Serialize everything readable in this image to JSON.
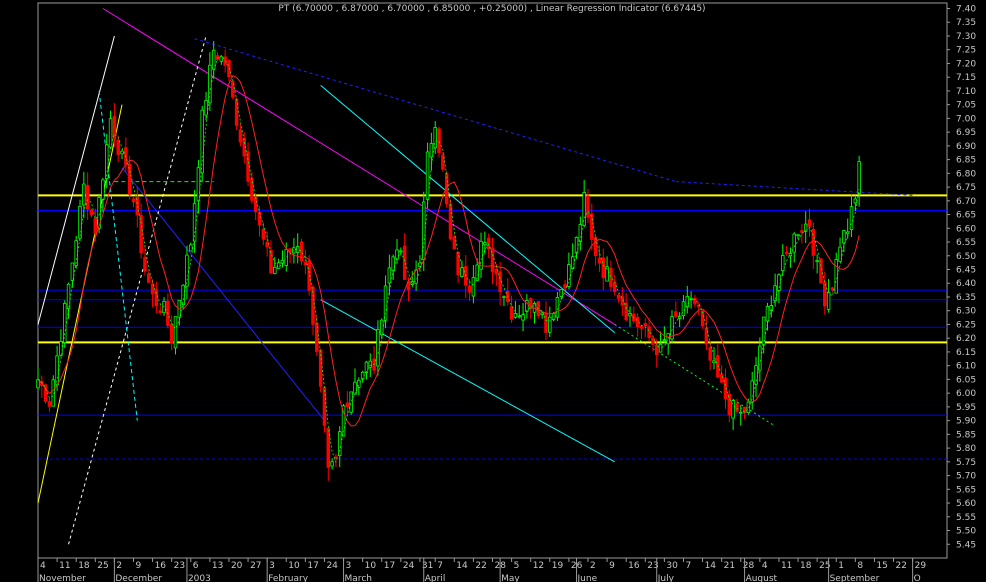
{
  "chart_data": {
    "type": "candlestick",
    "title": "PT (6.70000 , 6.87000 , 6.70000 , 6.85000 , +0.25000) , Linear Regression Indicator (6.67445)",
    "ylim": [
      5.4,
      7.42
    ],
    "yticks": [
      "7.40",
      "7.35",
      "7.30",
      "7.25",
      "7.20",
      "7.15",
      "7.10",
      "7.05",
      "7.00",
      "6.95",
      "6.90",
      "6.85",
      "6.80",
      "6.75",
      "6.70",
      "6.65",
      "6.60",
      "6.55",
      "6.50",
      "6.45",
      "6.40",
      "6.35",
      "6.30",
      "6.25",
      "6.20",
      "6.15",
      "6.10",
      "6.05",
      "6.00",
      "5.95",
      "5.90",
      "5.85",
      "5.80",
      "5.75",
      "5.70",
      "5.65",
      "5.60",
      "5.55",
      "5.50",
      "5.45"
    ],
    "xlim": [
      0,
      238
    ],
    "dayticks": [
      {
        "x": 0,
        "label": "4"
      },
      {
        "x": 5,
        "label": "11"
      },
      {
        "x": 10,
        "label": "18"
      },
      {
        "x": 15,
        "label": "25"
      },
      {
        "x": 20,
        "label": "2"
      },
      {
        "x": 25,
        "label": "9"
      },
      {
        "x": 30,
        "label": "16"
      },
      {
        "x": 35,
        "label": "23"
      },
      {
        "x": 40,
        "label": "6"
      },
      {
        "x": 45,
        "label": "13"
      },
      {
        "x": 50,
        "label": "20"
      },
      {
        "x": 55,
        "label": "27"
      },
      {
        "x": 60,
        "label": "3"
      },
      {
        "x": 65,
        "label": "10"
      },
      {
        "x": 70,
        "label": "17"
      },
      {
        "x": 75,
        "label": "24"
      },
      {
        "x": 80,
        "label": "3"
      },
      {
        "x": 85,
        "label": "10"
      },
      {
        "x": 90,
        "label": "17"
      },
      {
        "x": 95,
        "label": "24"
      },
      {
        "x": 100,
        "label": "31"
      },
      {
        "x": 104,
        "label": "7"
      },
      {
        "x": 109,
        "label": "14"
      },
      {
        "x": 114,
        "label": "22"
      },
      {
        "x": 119,
        "label": "28"
      },
      {
        "x": 124,
        "label": "5"
      },
      {
        "x": 129,
        "label": "12"
      },
      {
        "x": 134,
        "label": "19"
      },
      {
        "x": 139,
        "label": "26"
      },
      {
        "x": 144,
        "label": "2"
      },
      {
        "x": 149,
        "label": "9"
      },
      {
        "x": 154,
        "label": "16"
      },
      {
        "x": 159,
        "label": "23"
      },
      {
        "x": 164,
        "label": "30"
      },
      {
        "x": 169,
        "label": "7"
      },
      {
        "x": 174,
        "label": "14"
      },
      {
        "x": 179,
        "label": "21"
      },
      {
        "x": 184,
        "label": "28"
      },
      {
        "x": 189,
        "label": "4"
      },
      {
        "x": 194,
        "label": "11"
      },
      {
        "x": 199,
        "label": "18"
      },
      {
        "x": 204,
        "label": "25"
      },
      {
        "x": 209,
        "label": "1"
      },
      {
        "x": 214,
        "label": "8"
      },
      {
        "x": 219,
        "label": "15"
      },
      {
        "x": 224,
        "label": "22"
      },
      {
        "x": 229,
        "label": "29"
      }
    ],
    "months": [
      {
        "x": 0,
        "label": "November"
      },
      {
        "x": 20,
        "label": "December"
      },
      {
        "x": 39,
        "label": "2003"
      },
      {
        "x": 60,
        "label": "February"
      },
      {
        "x": 80,
        "label": "March"
      },
      {
        "x": 101,
        "label": "April"
      },
      {
        "x": 121,
        "label": "May"
      },
      {
        "x": 141,
        "label": "June"
      },
      {
        "x": 162,
        "label": "July"
      },
      {
        "x": 185,
        "label": "August"
      },
      {
        "x": 207,
        "label": "September"
      },
      {
        "x": 229,
        "label": "O"
      }
    ],
    "anchors": [
      [
        0,
        6.05
      ],
      [
        3,
        5.97
      ],
      [
        7,
        6.3
      ],
      [
        12,
        6.75
      ],
      [
        15,
        6.6
      ],
      [
        19,
        7.0
      ],
      [
        22,
        6.85
      ],
      [
        25,
        6.7
      ],
      [
        28,
        6.45
      ],
      [
        30,
        6.35
      ],
      [
        33,
        6.3
      ],
      [
        35,
        6.2
      ],
      [
        37,
        6.35
      ],
      [
        40,
        6.55
      ],
      [
        43,
        7.0
      ],
      [
        46,
        7.25
      ],
      [
        49,
        7.2
      ],
      [
        52,
        7.0
      ],
      [
        55,
        6.8
      ],
      [
        58,
        6.6
      ],
      [
        61,
        6.45
      ],
      [
        65,
        6.5
      ],
      [
        68,
        6.55
      ],
      [
        71,
        6.4
      ],
      [
        74,
        6.0
      ],
      [
        76,
        5.7
      ],
      [
        78,
        5.75
      ],
      [
        80,
        5.95
      ],
      [
        83,
        6.05
      ],
      [
        86,
        6.1
      ],
      [
        88,
        6.1
      ],
      [
        91,
        6.4
      ],
      [
        94,
        6.55
      ],
      [
        97,
        6.35
      ],
      [
        100,
        6.5
      ],
      [
        102,
        6.85
      ],
      [
        104,
        7.0
      ],
      [
        106,
        6.8
      ],
      [
        108,
        6.55
      ],
      [
        110,
        6.45
      ],
      [
        113,
        6.4
      ],
      [
        116,
        6.55
      ],
      [
        118,
        6.5
      ],
      [
        121,
        6.4
      ],
      [
        124,
        6.3
      ],
      [
        127,
        6.3
      ],
      [
        130,
        6.35
      ],
      [
        133,
        6.25
      ],
      [
        136,
        6.35
      ],
      [
        139,
        6.45
      ],
      [
        141,
        6.55
      ],
      [
        143,
        6.7
      ],
      [
        145,
        6.55
      ],
      [
        148,
        6.45
      ],
      [
        151,
        6.4
      ],
      [
        154,
        6.3
      ],
      [
        157,
        6.25
      ],
      [
        160,
        6.2
      ],
      [
        163,
        6.15
      ],
      [
        166,
        6.25
      ],
      [
        169,
        6.3
      ],
      [
        171,
        6.35
      ],
      [
        173,
        6.3
      ],
      [
        175,
        6.15
      ],
      [
        178,
        6.05
      ],
      [
        181,
        5.95
      ],
      [
        184,
        5.92
      ],
      [
        186,
        5.95
      ],
      [
        188,
        6.1
      ],
      [
        190,
        6.25
      ],
      [
        193,
        6.4
      ],
      [
        196,
        6.5
      ],
      [
        199,
        6.6
      ],
      [
        202,
        6.62
      ],
      [
        204,
        6.45
      ],
      [
        206,
        6.35
      ],
      [
        208,
        6.4
      ],
      [
        210,
        6.55
      ],
      [
        212,
        6.6
      ],
      [
        214,
        6.7
      ],
      [
        215,
        6.85
      ]
    ],
    "horizontal_levels": [
      {
        "value": 6.72,
        "color": "#ffff00",
        "width": 2
      },
      {
        "value": 6.185,
        "color": "#ffff00",
        "width": 2
      },
      {
        "value": 6.665,
        "color": "#0000ff",
        "width": 1
      },
      {
        "value": 6.375,
        "color": "#0000ff",
        "width": 1
      },
      {
        "value": 6.34,
        "color": "#0000ff",
        "width": 1
      },
      {
        "value": 6.24,
        "color": "#0000ff",
        "width": 1
      },
      {
        "value": 5.92,
        "color": "#0000ff",
        "width": 1
      },
      {
        "value": 5.76,
        "color": "#0000ff",
        "width": 1,
        "dash": "3,3"
      }
    ],
    "trendlines": [
      {
        "x1": 17,
        "y1": 7.4,
        "x2": 151,
        "y2": 6.25,
        "color": "#ff00ff",
        "dash": ""
      },
      {
        "x1": 41,
        "y1": 7.29,
        "x2": 167,
        "y2": 6.77,
        "color": "#2020ff",
        "dash": "3,3"
      },
      {
        "x1": 167,
        "y1": 6.77,
        "x2": 229,
        "y2": 6.72,
        "color": "#2020ff",
        "dash": "3,3"
      },
      {
        "x1": 74,
        "y1": 7.12,
        "x2": 151,
        "y2": 6.22,
        "color": "#00ffff",
        "dash": ""
      },
      {
        "x1": 74,
        "y1": 6.34,
        "x2": 151,
        "y2": 5.75,
        "color": "#00ffff",
        "dash": ""
      },
      {
        "x1": 22,
        "y1": 6.82,
        "x2": 75,
        "y2": 5.9,
        "color": "#2020ff",
        "dash": ""
      },
      {
        "x1": 0,
        "y1": 6.25,
        "x2": 20,
        "y2": 7.3,
        "color": "#ffffff",
        "dash": ""
      },
      {
        "x1": 0,
        "y1": 5.6,
        "x2": 22,
        "y2": 7.05,
        "color": "#ffff00",
        "dash": ""
      },
      {
        "x1": 8,
        "y1": 5.45,
        "x2": 44,
        "y2": 7.3,
        "color": "#ffffff",
        "dash": "3,3"
      },
      {
        "x1": 20,
        "y1": 6.77,
        "x2": 46,
        "y2": 6.77,
        "color": "#00ff00",
        "dash": "4,3"
      },
      {
        "x1": 16,
        "y1": 7.1,
        "x2": 26,
        "y2": 5.9,
        "color": "#00ffff",
        "dash": "4,3"
      },
      {
        "x1": 151,
        "y1": 6.25,
        "x2": 193,
        "y2": 5.88,
        "color": "#00ff00",
        "dash": "2,3"
      }
    ],
    "legend": "none",
    "grid": false
  }
}
